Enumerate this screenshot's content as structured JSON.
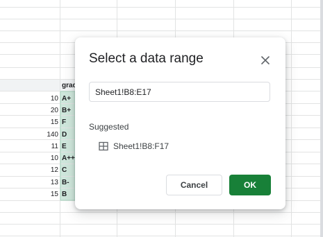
{
  "sheet": {
    "column_header": "grade",
    "rows": [
      {
        "num": "10",
        "grade": "A+"
      },
      {
        "num": "20",
        "grade": "B+"
      },
      {
        "num": "15",
        "grade": "F"
      },
      {
        "num": "140",
        "grade": "D"
      },
      {
        "num": "11",
        "grade": "E"
      },
      {
        "num": "10",
        "grade": "A++"
      },
      {
        "num": "12",
        "grade": "C"
      },
      {
        "num": "13",
        "grade": "B-"
      },
      {
        "num": "15",
        "grade": "B"
      }
    ],
    "colors": {
      "grid": "#e2e3e3",
      "selection_fill": "#cfe7dc",
      "selection_border": "#a8d5bf"
    }
  },
  "dialog": {
    "title": "Select a data range",
    "close_icon": "close-icon",
    "range_value": "Sheet1!B8:E17",
    "suggested_label": "Suggested",
    "suggestion": {
      "icon": "grid-table-icon",
      "text": "Sheet1!B8:F17"
    },
    "cancel_label": "Cancel",
    "ok_label": "OK",
    "colors": {
      "ok_bg": "#188038",
      "cancel_text": "#3c4043"
    }
  }
}
